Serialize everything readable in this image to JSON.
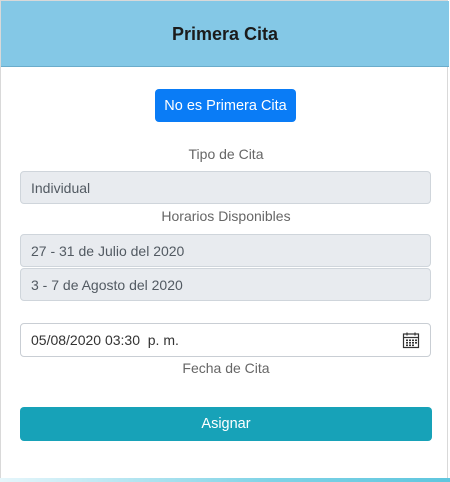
{
  "header": {
    "title": "Primera Cita"
  },
  "actions": {
    "not_first_label": "No es Primera Cita",
    "assign_label": "Asignar"
  },
  "tipo": {
    "label": "Tipo de Cita",
    "value": "Individual"
  },
  "horarios": {
    "label": "Horarios Disponibles",
    "options": [
      "27 - 31 de Julio del 2020",
      "3 - 7 de Agosto del 2020"
    ]
  },
  "fecha": {
    "value": "05/08/2020 03:30  p. m.",
    "label": "Fecha de Cita",
    "icon": "calendar-icon"
  },
  "colors": {
    "header": "#84c8e6",
    "primary": "#0a7cf6",
    "assign": "#17a2b8"
  }
}
